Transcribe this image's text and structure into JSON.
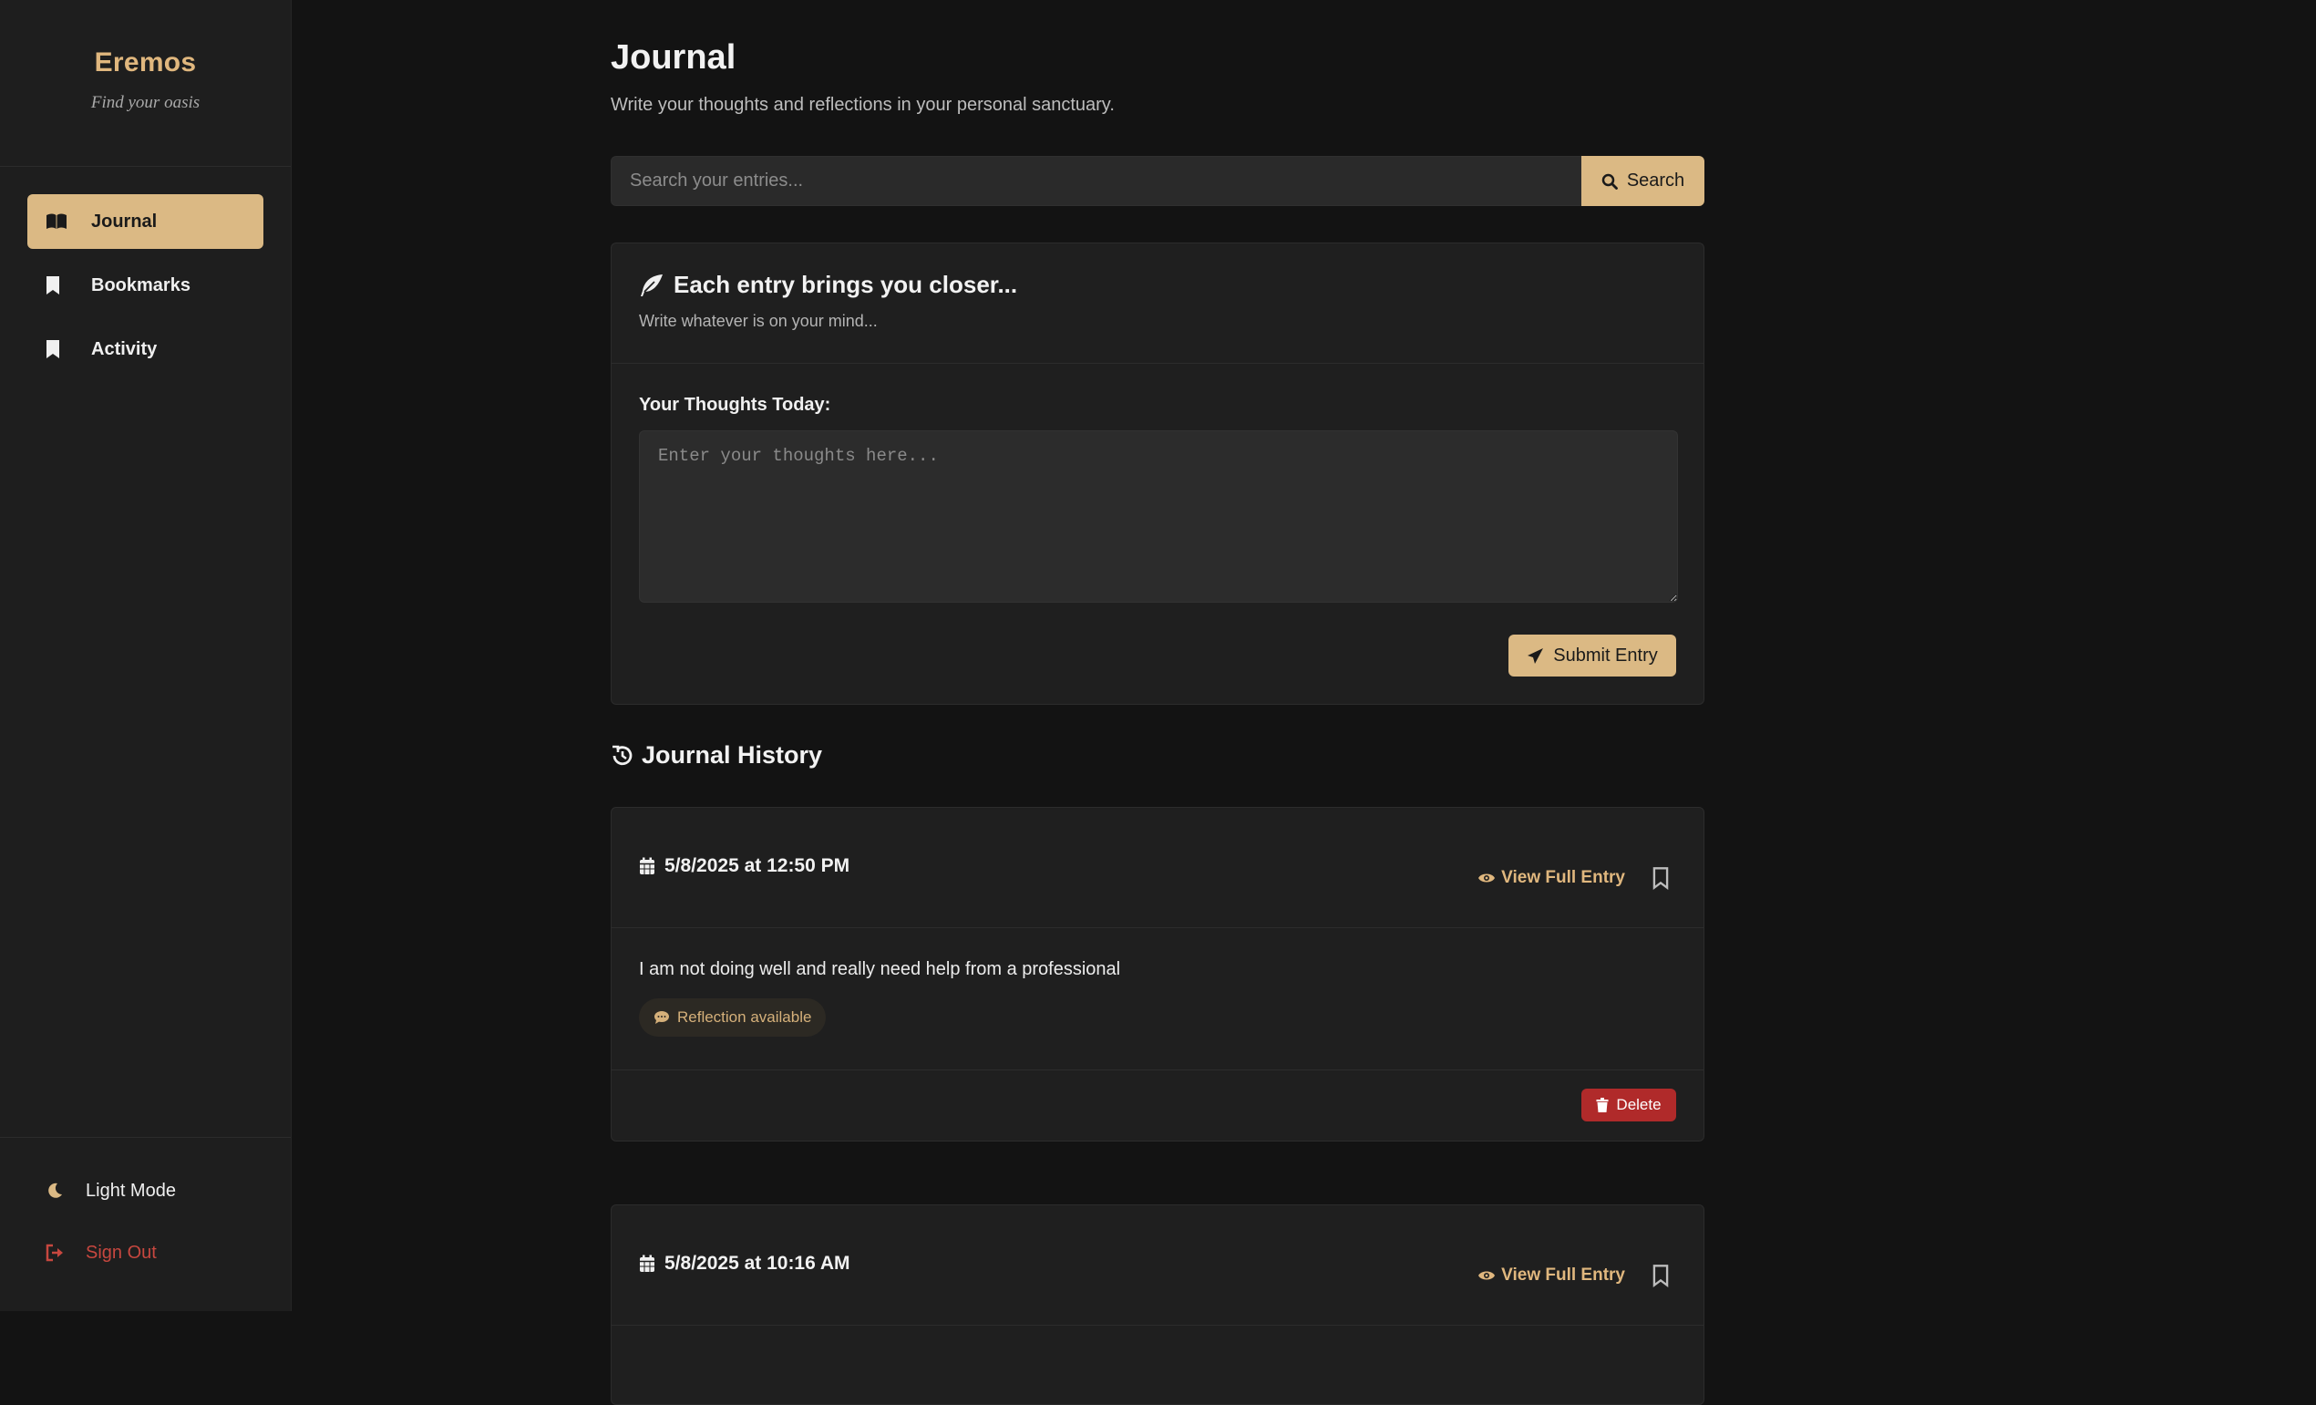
{
  "sidebar": {
    "brand_name": "Eremos",
    "brand_tagline": "Find your oasis",
    "nav": [
      {
        "label": "Journal",
        "icon": "book-open-icon",
        "active": true
      },
      {
        "label": "Bookmarks",
        "icon": "bookmark-icon",
        "active": false
      },
      {
        "label": "Activity",
        "icon": "bookmark-icon",
        "active": false
      }
    ],
    "theme_toggle_label": "Light Mode",
    "sign_out_label": "Sign Out"
  },
  "header": {
    "title": "Journal",
    "subtitle": "Write your thoughts and reflections in your personal sanctuary."
  },
  "search": {
    "placeholder": "Search your entries...",
    "value": "",
    "button_label": "Search"
  },
  "composer": {
    "title": "Each entry brings you closer...",
    "subtitle": "Write whatever is on your mind...",
    "field_label": "Your Thoughts Today:",
    "placeholder": "Enter your thoughts here...",
    "value": "",
    "submit_label": "Submit Entry"
  },
  "history": {
    "title": "Journal History",
    "view_label": "View Full Entry",
    "delete_label": "Delete",
    "entries": [
      {
        "date": "5/8/2025 at 12:50 PM",
        "text": "I am not doing well and really need help from a professional",
        "badge": "Reflection available"
      },
      {
        "date": "5/8/2025 at 10:16 AM"
      }
    ]
  },
  "colors": {
    "accent": "#dbb984",
    "accent_text": "#e0b77e",
    "background": "#131313",
    "sidebar": "#1e1e1e",
    "card": "#1f1f1f",
    "danger": "#b02a2a",
    "sign_out": "#c7473f"
  }
}
